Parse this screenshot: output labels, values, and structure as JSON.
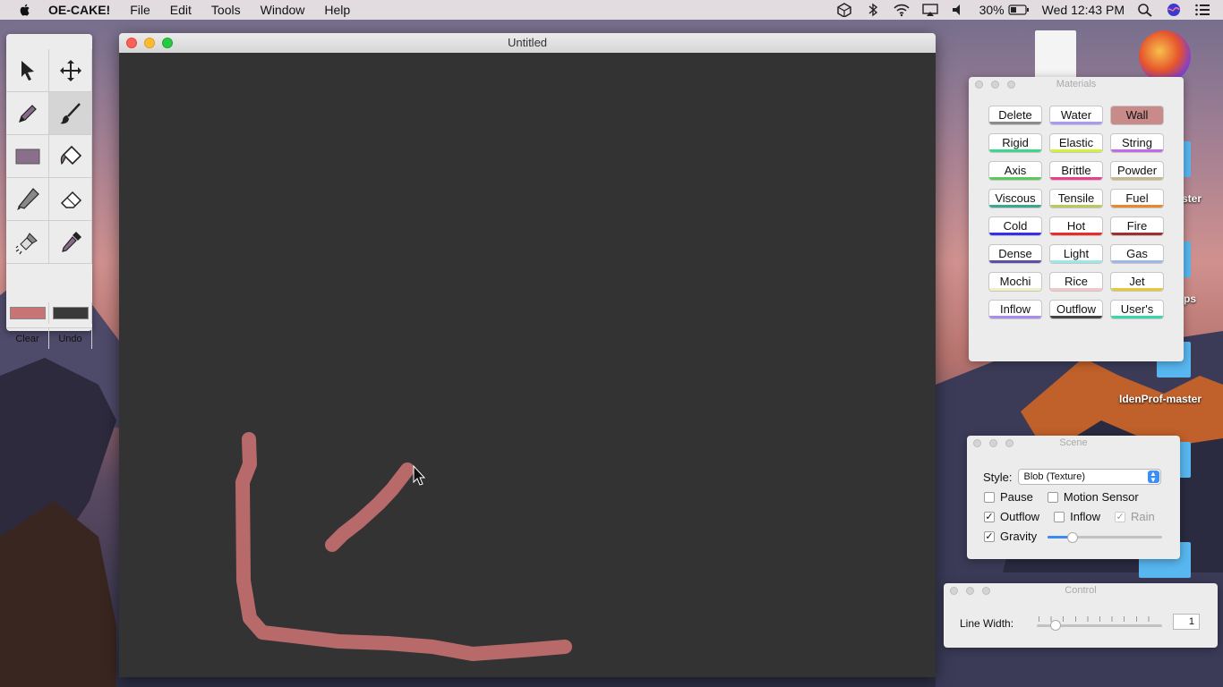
{
  "menubar": {
    "app_name": "OE-CAKE!",
    "items": [
      "File",
      "Edit",
      "Tools",
      "Window",
      "Help"
    ],
    "battery": "30%",
    "clock": "Wed 12:43 PM"
  },
  "desktop": {
    "labels": [
      "ster",
      "ps",
      "IdenProf-master"
    ]
  },
  "tool_palette": {
    "tools": [
      "select-arrow-icon",
      "move-icon",
      "pencil-icon",
      "brush-icon",
      "rectangle-icon",
      "fill-bucket-icon",
      "knife-icon",
      "eraser-icon",
      "flashlight-icon",
      "dropper-icon"
    ],
    "fore_color": "#c97474",
    "back_color": "#3a3a3a",
    "clear_label": "Clear",
    "undo_label": "Undo"
  },
  "main_window": {
    "title": "Untitled",
    "stroke_color": "#b86a6a"
  },
  "materials": {
    "title": "Materials",
    "items": [
      {
        "label": "Delete",
        "color": "#8c8c8c"
      },
      {
        "label": "Water",
        "color": "#a79cf0"
      },
      {
        "label": "Wall",
        "color": "#c98a8a"
      },
      {
        "label": "Rigid",
        "color": "#3ad98a"
      },
      {
        "label": "Elastic",
        "color": "#d6f03a"
      },
      {
        "label": "String",
        "color": "#c06be8"
      },
      {
        "label": "Axis",
        "color": "#5cc85c"
      },
      {
        "label": "Brittle",
        "color": "#e8408c"
      },
      {
        "label": "Powder",
        "color": "#c8b890"
      },
      {
        "label": "Viscous",
        "color": "#3aa88c"
      },
      {
        "label": "Tensile",
        "color": "#bcc85c"
      },
      {
        "label": "Fuel",
        "color": "#e8882c"
      },
      {
        "label": "Cold",
        "color": "#3a2ce8"
      },
      {
        "label": "Hot",
        "color": "#e82c2c"
      },
      {
        "label": "Fire",
        "color": "#a03030"
      },
      {
        "label": "Dense",
        "color": "#5a50a8"
      },
      {
        "label": "Light",
        "color": "#9ce8e8"
      },
      {
        "label": "Gas",
        "color": "#9cb8e8"
      },
      {
        "label": "Mochi",
        "color": "#f0f0c8"
      },
      {
        "label": "Rice",
        "color": "#f0c8c8"
      },
      {
        "label": "Jet",
        "color": "#e8c83a"
      },
      {
        "label": "Inflow",
        "color": "#a88cf0"
      },
      {
        "label": "Outflow",
        "color": "#444444"
      },
      {
        "label": "User's",
        "color": "#3ad8a8"
      }
    ],
    "selected": "Wall"
  },
  "scene": {
    "title": "Scene",
    "style_label": "Style:",
    "style_value": "Blob (Texture)",
    "pause_label": "Pause",
    "motion_label": "Motion Sensor",
    "outflow_label": "Outflow",
    "inflow_label": "Inflow",
    "rain_label": "Rain",
    "gravity_label": "Gravity",
    "gravity_value": 0.22
  },
  "control": {
    "title": "Control",
    "line_width_label": "Line Width:",
    "line_width_value": "1",
    "line_width_slider": 0.15
  }
}
